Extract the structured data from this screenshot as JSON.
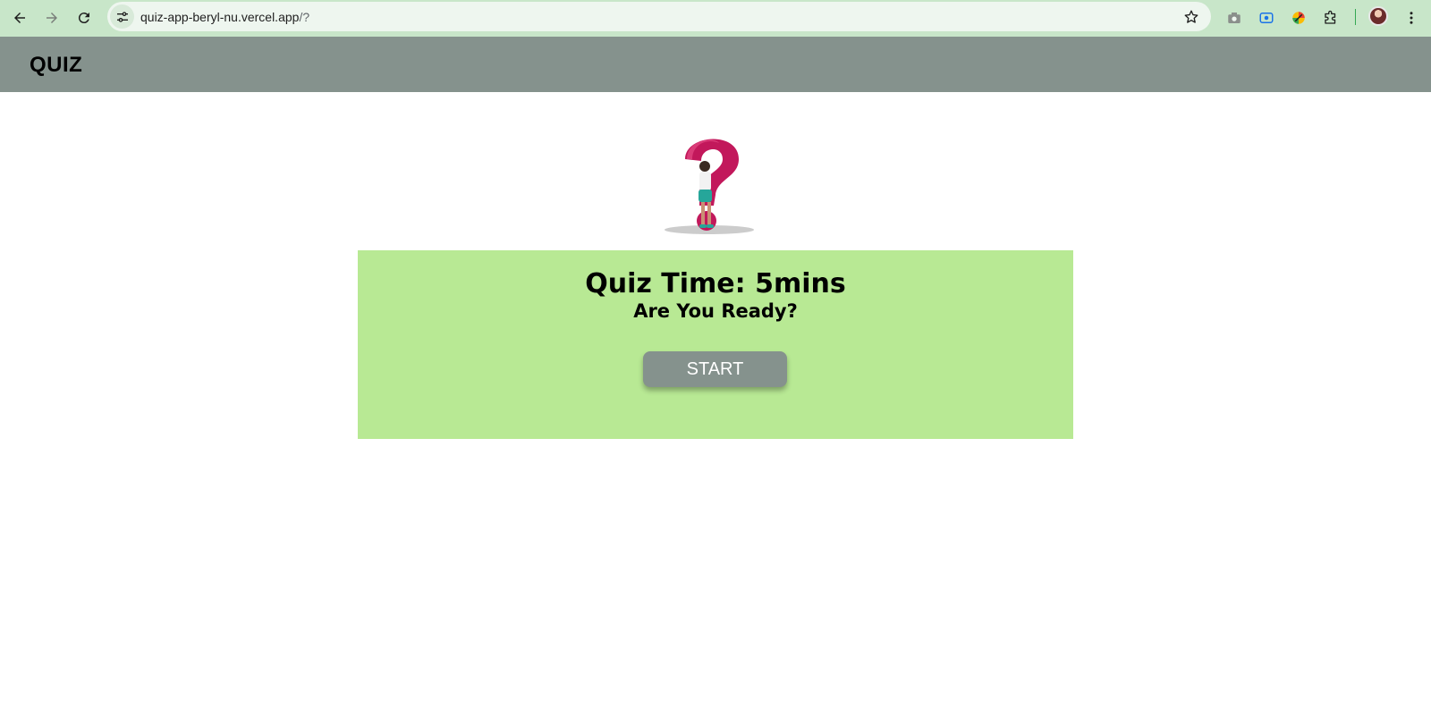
{
  "browser": {
    "url_host": "quiz-app-beryl-nu.vercel.app",
    "url_path": "/?",
    "back_icon": "arrow-left-icon",
    "forward_icon": "arrow-right-icon",
    "reload_icon": "reload-icon",
    "star_icon": "star-icon",
    "menu_icon": "kebab-menu-icon"
  },
  "header": {
    "title": "QUIZ",
    "background": "#85928d"
  },
  "hero": {
    "icon": "question-mark-person-illustration"
  },
  "card": {
    "title": "Quiz Time: 5mins",
    "subtitle": "Are You Ready?",
    "start_label": "START",
    "background": "#b8e994",
    "button_color": "#85928d"
  }
}
